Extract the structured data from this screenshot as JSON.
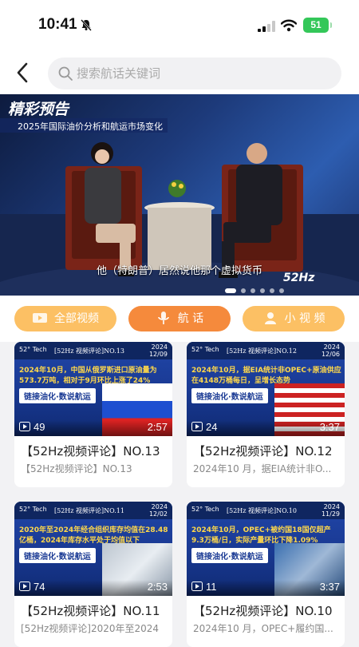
{
  "status": {
    "time": "10:41",
    "battery": "51"
  },
  "search": {
    "placeholder": "搜索航话关键词"
  },
  "banner": {
    "title": "精彩预告",
    "subtitle": "2025年国际油价分析和航运市场变化",
    "caption": "他（特朗普）居然说他那个虚拟货币",
    "logo": "52Hz"
  },
  "tabs": [
    {
      "label": "全部视频",
      "icon": "video-icon"
    },
    {
      "label": "航 话",
      "icon": "microphone-icon"
    },
    {
      "label": "小 视 频",
      "icon": "person-icon"
    }
  ],
  "videos": [
    {
      "series": "[52Hz 视频评论]NO.13",
      "year": "2024",
      "date": "12/09",
      "headline": "2024年10月，中国从俄罗斯进口原油量为573.7万吨，相对于9月环比上涨了24%",
      "tag": "链接油化·数说航运",
      "views": "49",
      "duration": "2:57",
      "title": "【52Hz视频评论】NO.13",
      "subtitle": "【52Hz视频评论】NO.13"
    },
    {
      "series": "[52Hz 视频评论]NO.12",
      "year": "2024",
      "date": "12/06",
      "headline": "2024年10月，据EIA统计非OPEC+原油供应在4148万桶每日，呈增长态势",
      "tag": "链接油化·数说航运",
      "views": "24",
      "duration": "3:37",
      "title": "【52Hz视频评论】NO.12",
      "subtitle": "2024年10 月，据EIA统计非O..."
    },
    {
      "series": "[52Hz 视频评论]NO.11",
      "year": "2024",
      "date": "12/02",
      "headline": "2020年至2024年经合组织库存均值在28.48亿桶，2024年库存水平处于均值以下",
      "tag": "链接油化·数说航运",
      "views": "74",
      "duration": "2:53",
      "title": "【52Hz视频评论】NO.11",
      "subtitle": "[52Hz视频评论]2020年至2024"
    },
    {
      "series": "[52Hz 视频评论]NO.10",
      "year": "2024",
      "date": "11/29",
      "headline": "2024年10月，OPEC+被约国18国仅超产9.3万桶/日，实际产量环比下降1.09%",
      "tag": "链接油化·数说航运",
      "views": "11",
      "duration": "3:37",
      "title": "【52Hz视频评论】NO.10",
      "subtitle": "2024年10 月，OPEC+履约国..."
    }
  ]
}
